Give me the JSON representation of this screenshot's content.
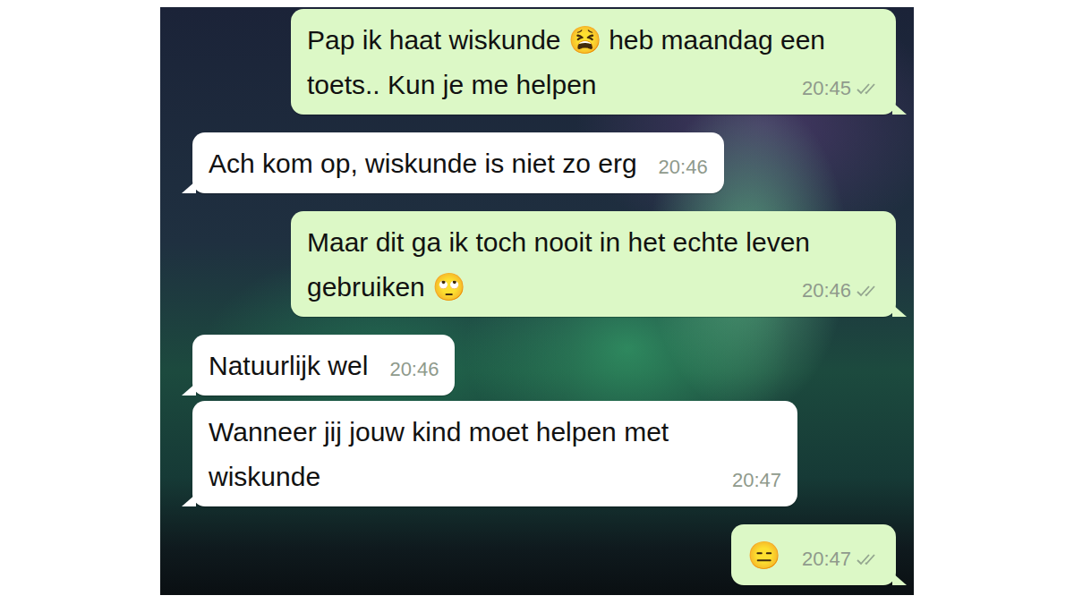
{
  "chat": {
    "messages": [
      {
        "kind": "outgoing",
        "text": "Pap ik haat wiskunde 😫 heb maandag een toets.. Kun je me helpen",
        "time": "20:45",
        "delivered": true
      },
      {
        "kind": "incoming",
        "text": "Ach kom op, wiskunde is niet zo erg",
        "time": "20:46",
        "delivered": false
      },
      {
        "kind": "outgoing",
        "text": "Maar dit ga ik toch nooit in het echte leven gebruiken 🙄",
        "time": "20:46",
        "delivered": true
      },
      {
        "kind": "incoming",
        "text": "Natuurlijk wel",
        "time": "20:46",
        "delivered": false
      },
      {
        "kind": "incoming",
        "text": "Wanneer jij jouw kind moet helpen met wiskunde",
        "time": "20:47",
        "delivered": false
      },
      {
        "kind": "outgoing",
        "text": "😑",
        "time": "20:47",
        "delivered": true
      }
    ]
  }
}
